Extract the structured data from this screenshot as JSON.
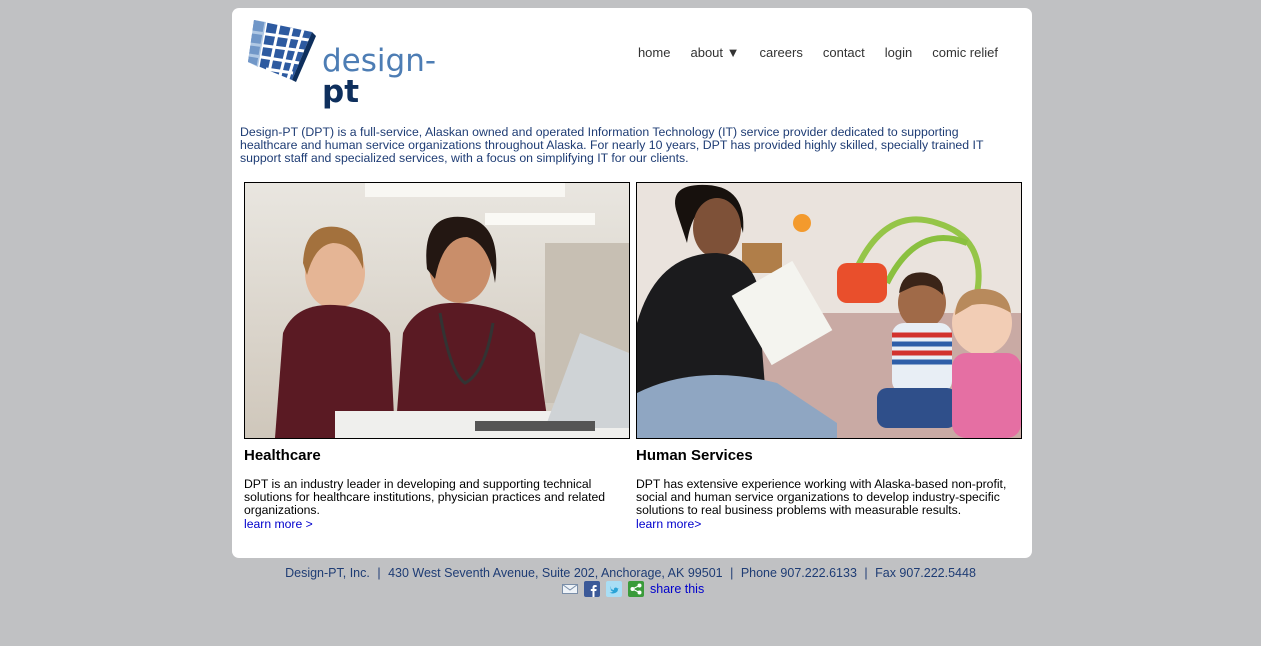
{
  "logo": {
    "text_main": "design-",
    "text_accent": "pt"
  },
  "nav": {
    "items": [
      {
        "label": "home"
      },
      {
        "label": "about ▼"
      },
      {
        "label": "careers"
      },
      {
        "label": "contact"
      },
      {
        "label": "login"
      },
      {
        "label": "comic relief"
      }
    ]
  },
  "intro": "Design-PT (DPT) is a full-service, Alaskan owned and operated Information Technology (IT) service provider dedicated to supporting healthcare and human service organizations throughout Alaska. For nearly 10 years, DPT has provided highly skilled, specially trained IT support staff and specialized services, with a focus on simplifying IT for our clients.",
  "sections": [
    {
      "title": "Healthcare",
      "body": "DPT is an industry leader in developing and supporting technical solutions for healthcare institutions, physician practices and related organizations.",
      "link": "learn more >"
    },
    {
      "title": "Human Services",
      "body": "DPT has extensive experience working with Alaska-based non-profit, social and human service organizations to develop industry-specific solutions to real business problems with measurable results.",
      "link": "learn more>"
    }
  ],
  "footer": {
    "company": "Design-PT, Inc.",
    "address": "430 West Seventh Avenue, Suite 202, Anchorage, AK 99501",
    "phone": "Phone 907.222.6133",
    "fax": "Fax 907.222.5448",
    "separator": "|",
    "share": "share this"
  },
  "colors": {
    "background": "#c0c1c3",
    "intro_text": "#1e3c74",
    "link": "#0000cc",
    "logo_blue": "#4d7db4",
    "logo_dark": "#0e2f5d"
  },
  "icons": [
    "email-icon",
    "facebook-icon",
    "twitter-icon",
    "share-icon"
  ]
}
